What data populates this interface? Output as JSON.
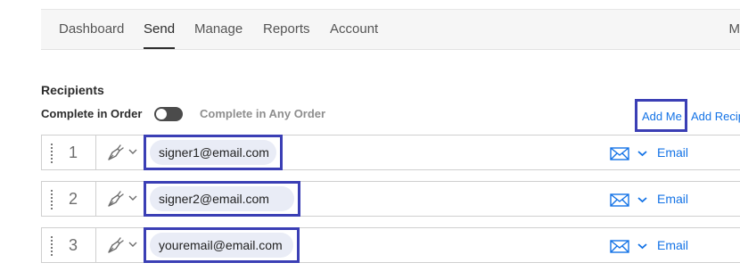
{
  "nav": {
    "items": [
      {
        "label": "Dashboard",
        "active": false
      },
      {
        "label": "Send",
        "active": true
      },
      {
        "label": "Manage",
        "active": false
      },
      {
        "label": "Reports",
        "active": false
      },
      {
        "label": "Account",
        "active": false
      }
    ],
    "overflow_label": "M"
  },
  "recipients": {
    "title": "Recipients",
    "complete_in_order_label": "Complete in Order",
    "complete_any_order_label": "Complete in Any Order",
    "toggle_state": "off",
    "add_me_label": "Add Me",
    "add_recipient_label": "Add Recip",
    "rows": [
      {
        "number": "1",
        "role_icon": "pen-signer-icon",
        "email": "signer1@email.com",
        "method_icon": "envelope-icon",
        "method": "Email"
      },
      {
        "number": "2",
        "role_icon": "pen-signer-icon",
        "email": "signer2@email.com",
        "method_icon": "envelope-icon",
        "method": "Email"
      },
      {
        "number": "3",
        "role_icon": "pen-signer-icon",
        "email": "youremail@email.com",
        "method_icon": "envelope-icon",
        "method": "Email"
      }
    ]
  },
  "colors": {
    "accent_link": "#1473e6",
    "highlight_outline": "#3b3fb5",
    "email_pill_bg": "#e9ecf6",
    "toggle_bg": "#4b4b4b"
  }
}
